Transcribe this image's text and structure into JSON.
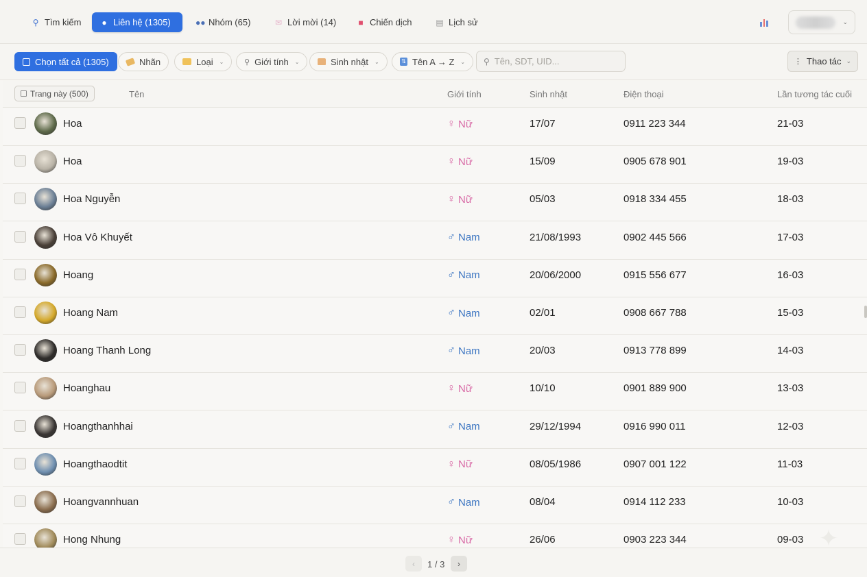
{
  "nav": {
    "tabs": [
      {
        "label": "Tìm kiếm",
        "icon": "search-icon"
      },
      {
        "label": "Liên hệ (1305)",
        "icon": "person-icon"
      },
      {
        "label": "Nhóm (65)",
        "icon": "group-icon"
      },
      {
        "label": "Lời mời (14)",
        "icon": "envelope-icon"
      },
      {
        "label": "Chiến dịch",
        "icon": "megaphone-icon"
      },
      {
        "label": "Lịch sử",
        "icon": "clipboard-icon"
      }
    ],
    "active_tab": 1
  },
  "toolbar": {
    "select_all": "Chọn tất cả (1305)",
    "label_filter": "Nhãn",
    "type_filter": "Loại",
    "gender_filter": "Giới tính",
    "birthday_filter": "Sinh nhật",
    "sort": "Tên A → Z",
    "search_placeholder": "Tên, SDT, UID...",
    "actions": "Thao tác"
  },
  "table": {
    "page_select": "Trang này (500)",
    "headers": {
      "name": "Tên",
      "gender": "Giới tính",
      "birthday": "Sinh nhật",
      "phone": "Điện thoại",
      "last": "Lần tương tác cuối"
    },
    "rows": [
      {
        "name": "Hoa",
        "gender": "Nữ",
        "birthday": "17/07",
        "phone": "0911 223 344",
        "last": "21-03"
      },
      {
        "name": "Hoa",
        "gender": "Nữ",
        "birthday": "15/09",
        "phone": "0905 678 901",
        "last": "19-03"
      },
      {
        "name": "Hoa Nguyễn",
        "gender": "Nữ",
        "birthday": "05/03",
        "phone": "0918 334 455",
        "last": "18-03"
      },
      {
        "name": "Hoa Vô Khuyết",
        "gender": "Nam",
        "birthday": "21/08/1993",
        "phone": "0902 445 566",
        "last": "17-03"
      },
      {
        "name": "Hoang",
        "gender": "Nam",
        "birthday": "20/06/2000",
        "phone": "0915 556 677",
        "last": "16-03"
      },
      {
        "name": "Hoang Nam",
        "gender": "Nam",
        "birthday": "02/01",
        "phone": "0908 667 788",
        "last": "15-03"
      },
      {
        "name": "Hoang Thanh Long",
        "gender": "Nam",
        "birthday": "20/03",
        "phone": "0913 778 899",
        "last": "14-03"
      },
      {
        "name": "Hoanghau",
        "gender": "Nữ",
        "birthday": "10/10",
        "phone": "0901 889 900",
        "last": "13-03"
      },
      {
        "name": "Hoangthanhhai",
        "gender": "Nam",
        "birthday": "29/12/1994",
        "phone": "0916 990 011",
        "last": "12-03"
      },
      {
        "name": "Hoangthaodtit",
        "gender": "Nữ",
        "birthday": "08/05/1986",
        "phone": "0907 001 122",
        "last": "11-03"
      },
      {
        "name": "Hoangvannhuan",
        "gender": "Nam",
        "birthday": "08/04",
        "phone": "0914 112 233",
        "last": "10-03"
      },
      {
        "name": "Hong Nhung",
        "gender": "Nữ",
        "birthday": "26/06",
        "phone": "0903 223 344",
        "last": "09-03"
      }
    ]
  },
  "pagination": {
    "info": "1 / 3",
    "prev": "‹",
    "next": "›"
  },
  "colors": {
    "accent": "#2f6fe0",
    "female": "#d86aa6",
    "male": "#3d76c2"
  }
}
